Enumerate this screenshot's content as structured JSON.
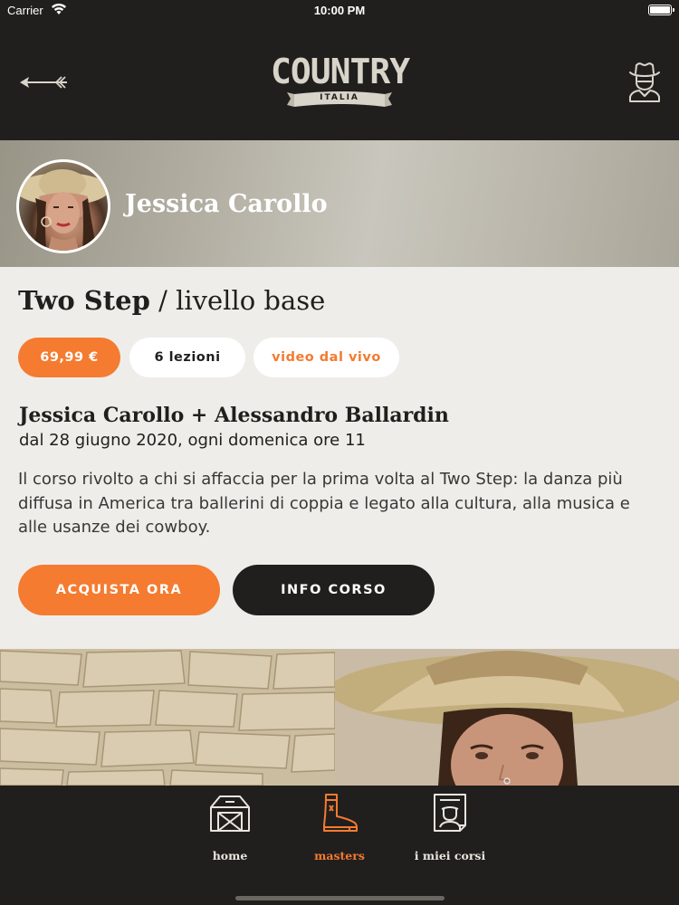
{
  "status_bar": {
    "carrier": "Carrier",
    "time": "10:00 PM"
  },
  "header": {
    "logo_word": "COUNTRY",
    "logo_sub": "ITALIA",
    "back_icon": "arrow-left-icon",
    "profile_icon": "cowboy-user-icon"
  },
  "instructor": {
    "name": "Jessica Carollo"
  },
  "course": {
    "title": "Two Step",
    "level": " / livello base",
    "price": "69,99 €",
    "lessons": "6 lezioni",
    "format": "video dal vivo",
    "teachers": "Jessica Carollo + Alessandro Ballardin",
    "schedule": "dal 28 giugno 2020, ogni domenica ore 11",
    "description": "Il corso rivolto a chi si affaccia per la prima volta al Two Step: la danza più diffusa in America tra ballerini di coppia e legato alla cultura, alla musica e alle usanze dei cowboy.",
    "buy_label": "ACQUISTA ORA",
    "info_label": "INFO CORSO"
  },
  "tabs": [
    {
      "label": "home",
      "icon": "barn-icon",
      "active": false
    },
    {
      "label": "masters",
      "icon": "boot-icon",
      "active": true
    },
    {
      "label": "i miei corsi",
      "icon": "wanted-poster-icon",
      "active": false
    }
  ],
  "colors": {
    "accent": "#f47b30",
    "dark": "#211f1d",
    "card": "#efede9"
  }
}
